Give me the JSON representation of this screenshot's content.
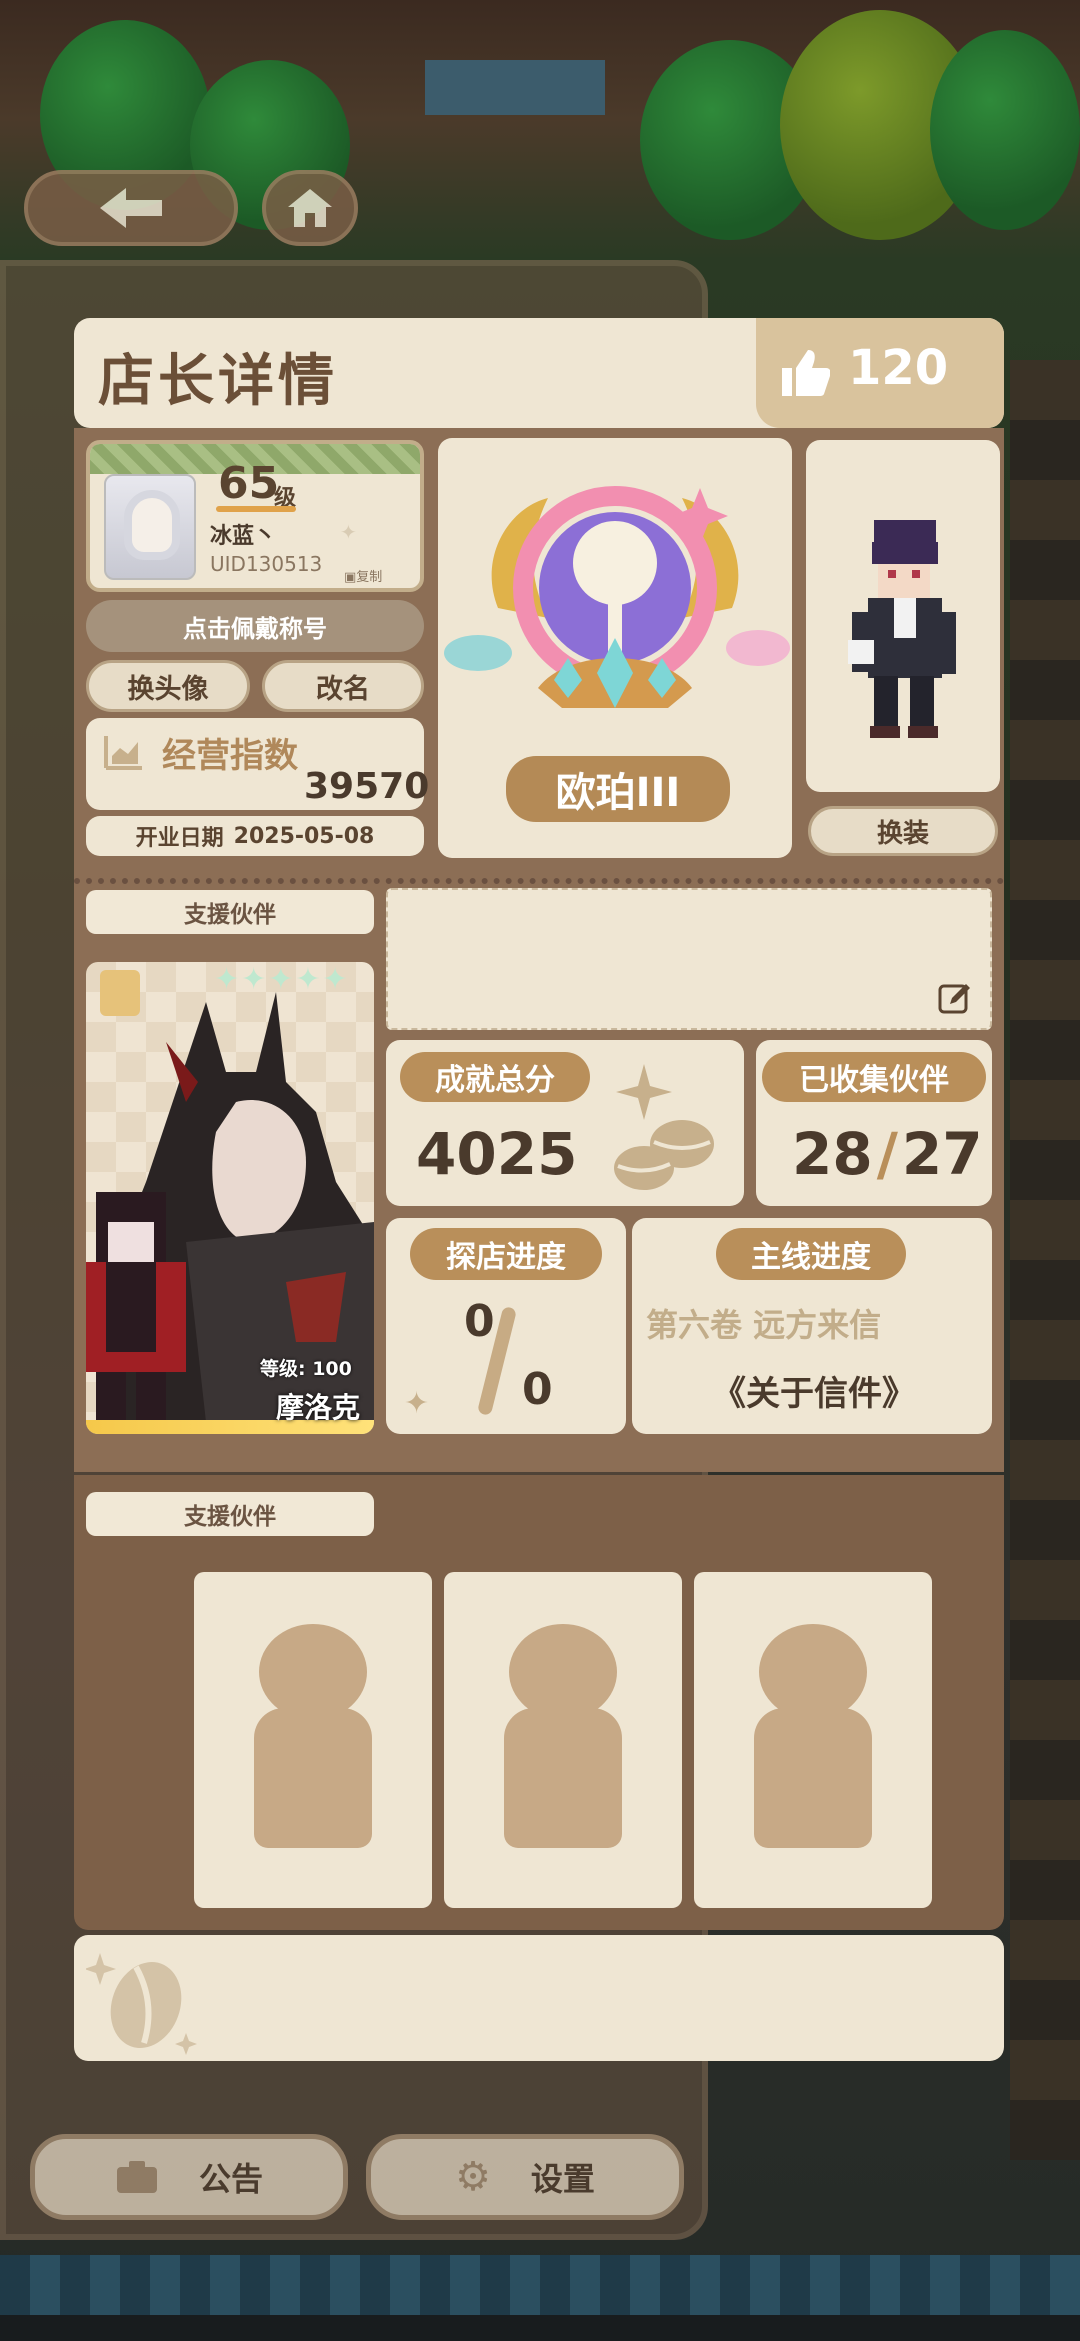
{
  "header": {
    "title": "店长详情",
    "likes": "120"
  },
  "profile": {
    "level": "65",
    "level_unit": "级",
    "name": "冰蓝丶",
    "uid": "UID130513",
    "copy_label": "复制",
    "title_button": "点击佩戴称号",
    "change_avatar": "换头像",
    "rename": "改名",
    "business_index_label": "经营指数",
    "business_index_value": "39570",
    "open_date_label": "开业日期",
    "open_date": "2025-05-08"
  },
  "rank": {
    "name": "欧珀III"
  },
  "outfit": {
    "change_outfit": "换装"
  },
  "partner": {
    "section_label": "支援伙伴",
    "level_label": "等级: 100",
    "name": "摩洛克"
  },
  "stats": {
    "achievement_label": "成就总分",
    "achievement_value": "4025",
    "collected_label": "已收集伙伴",
    "collected_value": "28",
    "collected_total": "27",
    "visit_label": "探店进度",
    "visit_current": "0",
    "visit_total": "0",
    "story_label": "主线进度",
    "story_volume": "第六卷 远方来信",
    "story_chapter": "《关于信件》"
  },
  "support2": {
    "section_label": "支援伙伴"
  },
  "bottom": {
    "notice": "公告",
    "settings": "设置"
  },
  "colors": {
    "accent": "#b98f5a",
    "card": "#efe6d3",
    "panel": "#8c6e55"
  }
}
